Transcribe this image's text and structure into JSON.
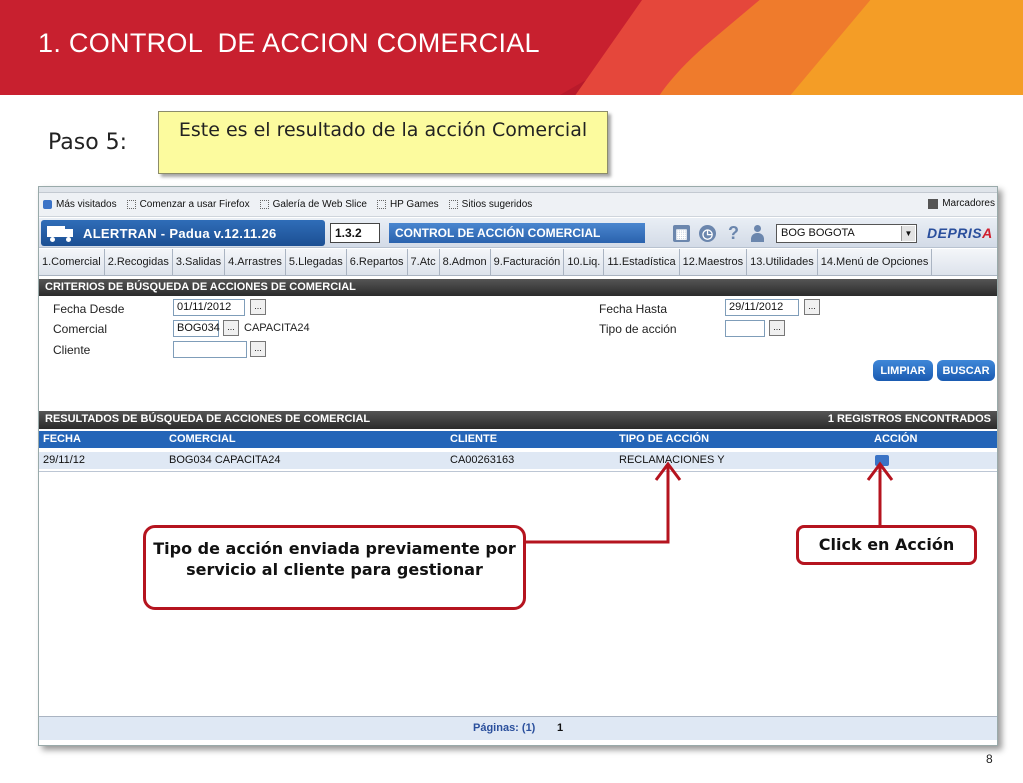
{
  "slide": {
    "title": "1. CONTROL  DE ACCION COMERCIAL",
    "step_label": "Paso 5:",
    "step_note": "Este es el resultado de la acción Comercial",
    "page_number": "8"
  },
  "browser": {
    "bookmarks": [
      "Más visitados",
      "Comenzar a usar Firefox",
      "Galería de Web Slice",
      "HP Games",
      "Sitios sugeridos"
    ],
    "bookmarks_right": "Marcadores"
  },
  "app": {
    "name": "ALERTRAN - Padua  v.12.11.26",
    "module_code": "1.3.2",
    "module_title": "CONTROL DE ACCIÓN COMERCIAL",
    "city": "BOG BOGOTA",
    "logo_left": "DEPRIS",
    "logo_right": "A",
    "menu": [
      "1.Comercial",
      "2.Recogidas",
      "3.Salidas",
      "4.Arrastres",
      "5.Llegadas",
      "6.Repartos",
      "7.Atc",
      "8.Admon",
      "9.Facturación",
      "10.Liq.",
      "11.Estadística",
      "12.Maestros",
      "13.Utilidades",
      "14.Menú de Opciones"
    ]
  },
  "criteria": {
    "title": "CRITERIOS DE BÚSQUEDA DE ACCIONES DE COMERCIAL",
    "fecha_desde_label": "Fecha Desde",
    "fecha_desde": "01/11/2012",
    "comercial_label": "Comercial",
    "comercial_code": "BOG034",
    "comercial_name": "CAPACITA24",
    "cliente_label": "Cliente",
    "cliente": "",
    "fecha_hasta_label": "Fecha Hasta",
    "fecha_hasta": "29/11/2012",
    "tipo_accion_label": "Tipo de acción",
    "tipo_accion": "",
    "dots": "...",
    "limpiar": "LIMPIAR",
    "buscar": "BUSCAR"
  },
  "results": {
    "title": "RESULTADOS DE BÚSQUEDA DE ACCIONES DE COMERCIAL",
    "count": "1 REGISTROS ENCONTRADOS",
    "columns": [
      "FECHA",
      "COMERCIAL",
      "CLIENTE",
      "TIPO DE ACCIÓN",
      "ACCIÓN"
    ],
    "rows": [
      {
        "fecha": "29/11/12",
        "comercial": "BOG034 CAPACITA24",
        "cliente": "CA00263163",
        "tipo": "RECLAMACIONES Y"
      }
    ],
    "pager_label": "Páginas: (1)",
    "pager_current": "1"
  },
  "callouts": {
    "tipo": "Tipo de acción enviada previamente  por servicio al cliente para gestionar",
    "accion": "Click en Acción"
  },
  "colors": {
    "banner": "#c8202f",
    "callout_border": "#b5141f",
    "app_blue": "#2465b8",
    "note_yellow": "#fcfb9e"
  }
}
